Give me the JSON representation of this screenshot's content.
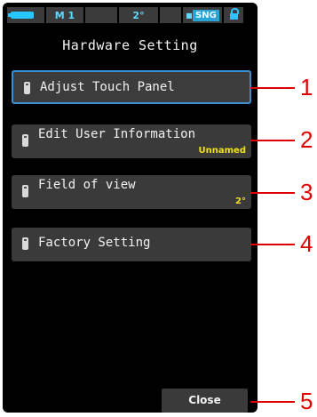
{
  "status_bar": {
    "battery_icon": "battery-icon",
    "mode": "M  1",
    "angle": "2°",
    "memory_icon": "memory-icon",
    "measure_mode": "SNG",
    "lock_icon": "lock-icon",
    "accent_color": "#27c6ff"
  },
  "title": "Hardware Setting",
  "menu": [
    {
      "label": "Adjust Touch Panel",
      "value": "",
      "icon": "menu-item-icon",
      "selected": true,
      "callout": "1"
    },
    {
      "label": "Edit User Information",
      "value": "Unnamed",
      "icon": "menu-item-icon",
      "selected": false,
      "callout": "2"
    },
    {
      "label": "Field of view",
      "value": "2°",
      "icon": "menu-item-icon",
      "selected": false,
      "callout": "3"
    },
    {
      "label": "Factory Setting",
      "value": "",
      "icon": "menu-item-icon",
      "selected": false,
      "callout": "4"
    }
  ],
  "close_button": {
    "label": "Close",
    "callout": "5"
  },
  "colors": {
    "screen_bg": "#000000",
    "button_bg": "#3a3a3a",
    "value_text": "#f0e020",
    "callout": "#e00000",
    "selection_border": "#3a8fd0"
  }
}
